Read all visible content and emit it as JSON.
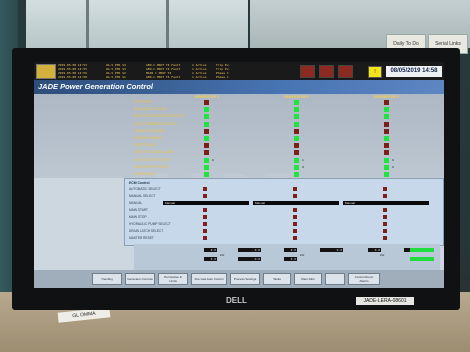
{
  "room": {
    "wall_notes": [
      "Daily To Do",
      "Serial Links"
    ],
    "desk_label": "GL OMMA",
    "monitor_brand": "DELL",
    "asset_tag": "JADE-LERA-08601"
  },
  "alarms": [
    {
      "time": "2019.05.08 14:53",
      "tag": "UA.5_PM1 S4",
      "desc": "GEN.C.PROT T4 Fault",
      "limit": "1 Active",
      "value": "Trip Ev."
    },
    {
      "time": "2019.05.08 14:55",
      "tag": "UA.5_PM1 S3",
      "desc": "GEN.C.PROT T4 Fault",
      "limit": "1 Active",
      "value": "Trip Ev."
    },
    {
      "time": "2019.05.08 14:56",
      "tag": "UA.5_PM1 S2",
      "desc": "MAIN C PROT T4",
      "limit": "1 Active",
      "value": "Phase C"
    },
    {
      "time": "2019.05.08 14:58",
      "tag": "UA.5_PM1 S1",
      "desc": "GEN.C.PROT T4 Fault",
      "limit": "1 Active",
      "value": "Phase C"
    }
  ],
  "header": {
    "date_time": "08/05/2019  14:58",
    "page_title": "JADE Power Generation Control",
    "watermark": "JADE"
  },
  "units": [
    "GENERATOR 1",
    "GENERATOR 2",
    "GENERATOR 3"
  ],
  "permissive_labels": [
    "PCP READY",
    "AVAILABLE TO START",
    "REMOTE OPERATION SELECTED",
    "CIRCUIT BREAKER IN AUTO",
    "ENGINE PRESSURE",
    "ENGINE RUNNING",
    "START FAILED",
    "MASTER LOADING ALARM",
    "VOLTAGE TRIP STATUS",
    "BUS BAR TRIP STATUS",
    "STAND-DOWN"
  ],
  "permissive_states": [
    [
      "red",
      "green",
      "red"
    ],
    [
      "green",
      "green",
      "green"
    ],
    [
      "green",
      "green",
      "green"
    ],
    [
      "green",
      "green",
      "red"
    ],
    [
      "red",
      "red",
      "red"
    ],
    [
      "green",
      "green",
      "green"
    ],
    [
      "red",
      "red",
      "red"
    ],
    [
      "red",
      "red",
      "red"
    ],
    [
      "green",
      "green",
      "green"
    ],
    [
      "green",
      "green",
      "green"
    ],
    [
      "green",
      "green",
      "green"
    ]
  ],
  "lamp_values": [
    {
      "row": 8,
      "unit": 0,
      "text": "0"
    },
    {
      "row": 8,
      "unit": 1,
      "text": "1"
    },
    {
      "row": 8,
      "unit": 2,
      "text": "0"
    },
    {
      "row": 9,
      "unit": 1,
      "text": "0"
    },
    {
      "row": 9,
      "unit": 2,
      "text": "0"
    }
  ],
  "controls": {
    "title": "ECM Control",
    "labels": [
      "AUTOMATIC SELECT",
      "MANUAL SELECT",
      "MANUAL",
      "MAIN START",
      "MAIN STOP",
      "HYDRAULIC PUMP SELECT",
      "DRAIN LATCH SELECT",
      "MASTER RESET"
    ],
    "mode_values": [
      "Manual",
      "Manual",
      "Manual"
    ]
  },
  "meters": {
    "values": [
      "0.0",
      "0.0",
      "0.0",
      "0.0",
      "0.0",
      "0.0",
      "0.0",
      "0.0",
      "0.0"
    ],
    "units": [
      "kW",
      "kW",
      "kW"
    ]
  },
  "navigation": [
    "Trending",
    "Generator Controls",
    "Permissive & Limits",
    "Fire Gas Auto Control",
    "Process Settings",
    "Tanks",
    "Main F&G",
    "",
    "Control Room Alarms"
  ],
  "colors": {
    "lamp_green": "#1ee43d",
    "lamp_red": "#7c1f18",
    "title_bar": "#3f68a3",
    "date_text": "#10224a"
  }
}
